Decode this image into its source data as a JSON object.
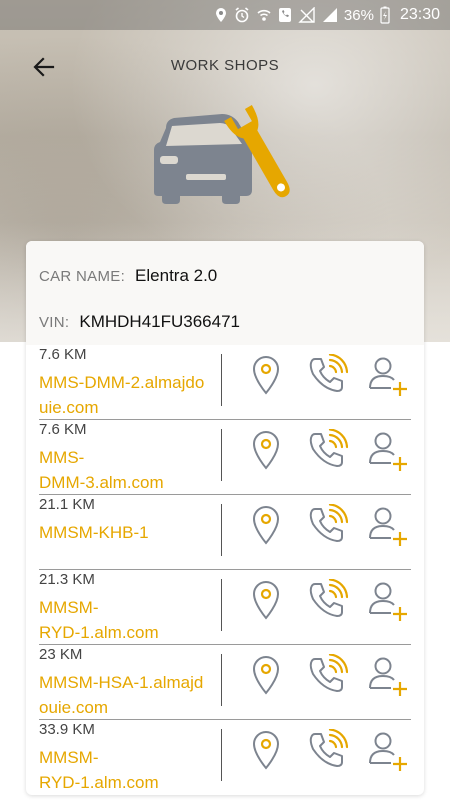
{
  "status_bar": {
    "battery": "36%",
    "time": "23:30"
  },
  "header": {
    "title": "WORK SHOPS"
  },
  "car": {
    "name_label": "CAR NAME:",
    "name": "Elentra 2.0",
    "vin_label": "VIN:",
    "vin": "KMHDH41FU366471"
  },
  "workshops": [
    {
      "distance": "7.6 KM",
      "name": "MMS-DMM-2.almajdouie.com"
    },
    {
      "distance": "7.6 KM",
      "name": "MMS-\nDMM-3.alm.com"
    },
    {
      "distance": "21.1 KM",
      "name": "MMSM-KHB-1"
    },
    {
      "distance": "21.3 KM",
      "name": "MMSM-\nRYD-1.alm.com"
    },
    {
      "distance": "23 KM",
      "name": "MMSM-HSA-1.almajdouie.com"
    },
    {
      "distance": "33.9 KM",
      "name": "MMSM-\nRYD-1.alm.com"
    }
  ],
  "colors": {
    "accent": "#E6A700",
    "icon_grey": "#7D848F",
    "text_dark": "#111111",
    "label_grey": "#7A7A7A"
  },
  "icons": {
    "back": "arrow-left-icon",
    "hero": "car-wrench-icon",
    "map": "map-pin-icon",
    "call": "phone-ringing-icon",
    "user": "add-user-icon"
  }
}
